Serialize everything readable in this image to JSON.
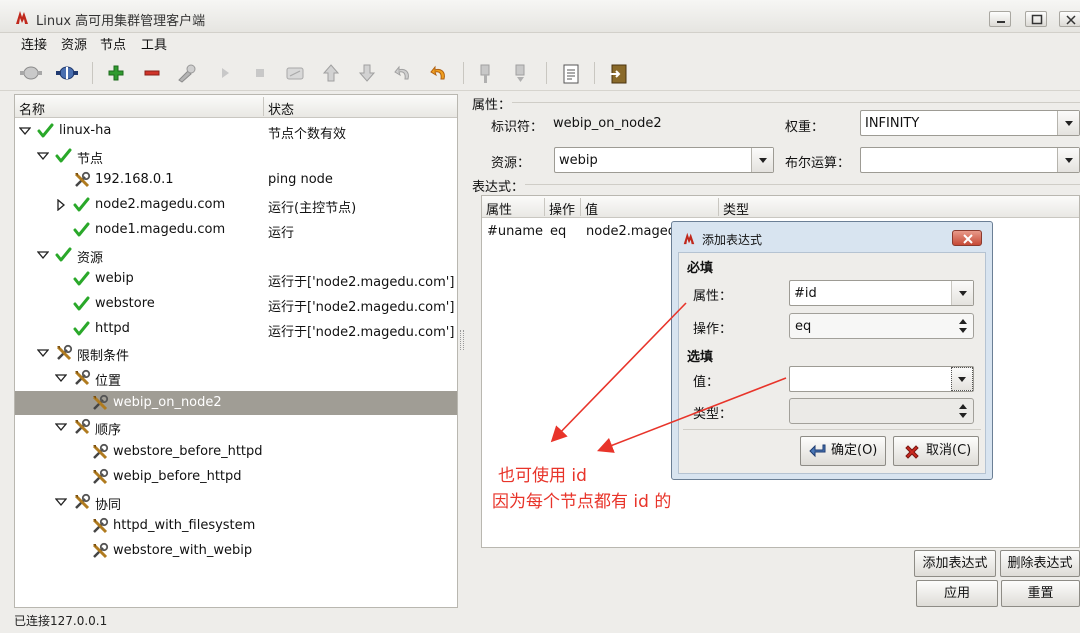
{
  "window": {
    "title": "Linux 高可用集群管理客户端"
  },
  "menu": [
    "连接",
    "资源",
    "节点",
    "工具"
  ],
  "toolbar_icons": [
    "connect-icon",
    "disconnect-icon",
    "add-icon",
    "remove-icon",
    "cleanup-icon",
    "start-icon",
    "stop-icon",
    "migrate-icon",
    "up-icon",
    "down-icon",
    "undo-icon",
    "refresh-icon",
    "standby-icon",
    "active-icon",
    "log-icon",
    "exit-icon"
  ],
  "tree": {
    "headers": {
      "name": "名称",
      "status": "状态"
    },
    "rows": [
      {
        "label": "linux-ha",
        "status": "节点个数有效",
        "icon": "check-icon"
      },
      {
        "label": "节点",
        "status": "",
        "icon": "check-icon"
      },
      {
        "label": "192.168.0.1",
        "status": "ping node",
        "icon": "tools-icon"
      },
      {
        "label": "node2.magedu.com",
        "status": "运行(主控节点)",
        "icon": "check-icon"
      },
      {
        "label": "node1.magedu.com",
        "status": "运行",
        "icon": "check-icon"
      },
      {
        "label": "资源",
        "status": "",
        "icon": "check-icon"
      },
      {
        "label": "webip",
        "status": "运行于['node2.magedu.com']",
        "icon": "check-icon"
      },
      {
        "label": "webstore",
        "status": "运行于['node2.magedu.com']",
        "icon": "check-icon"
      },
      {
        "label": "httpd",
        "status": "运行于['node2.magedu.com']",
        "icon": "check-icon"
      },
      {
        "label": "限制条件",
        "status": "",
        "icon": "tools-icon"
      },
      {
        "label": "位置",
        "status": "",
        "icon": "tools-icon"
      },
      {
        "label": "webip_on_node2",
        "status": "",
        "icon": "tools-icon"
      },
      {
        "label": "顺序",
        "status": "",
        "icon": "tools-icon"
      },
      {
        "label": "webstore_before_httpd",
        "status": "",
        "icon": "tools-icon"
      },
      {
        "label": "webip_before_httpd",
        "status": "",
        "icon": "tools-icon"
      },
      {
        "label": "协同",
        "status": "",
        "icon": "tools-icon"
      },
      {
        "label": "httpd_with_filesystem",
        "status": "",
        "icon": "tools-icon"
      },
      {
        "label": "webstore_with_webip",
        "status": "",
        "icon": "tools-icon"
      }
    ]
  },
  "properties": {
    "section_label": "属性：",
    "id_label": "标识符：",
    "id_value": "webip_on_node2",
    "weight_label": "权重：",
    "weight_value": "INFINITY",
    "resource_label": "资源：",
    "resource_value": "webip",
    "bool_label": "布尔运算：",
    "bool_value": ""
  },
  "expressions": {
    "section_label": "表达式：",
    "headers": [
      "属性",
      "操作",
      "值",
      "类型"
    ],
    "row": [
      "#uname",
      "eq",
      "node2.magedu.com",
      ""
    ],
    "add_button": "添加表达式",
    "delete_button": "删除表达式"
  },
  "actions": {
    "apply": "应用",
    "reset": "重置"
  },
  "status_bar": "已连接127.0.0.1",
  "dialog": {
    "title": "添加表达式",
    "required_title": "必填",
    "attr_label": "属性：",
    "attr_value": "#id",
    "op_label": "操作：",
    "op_value": "eq",
    "optional_title": "选填",
    "value_label": "值：",
    "value_value": "",
    "type_label": "类型：",
    "type_value": "",
    "ok_button": "确定(O)",
    "cancel_button": "取消(C)"
  },
  "annotation": {
    "line1": "也可使用 id",
    "line2": "因为每个节点都有 id 的"
  },
  "colors": {
    "annotation": "#e8342a",
    "selected_row": "#a09d95",
    "check": "#2aa82a"
  }
}
